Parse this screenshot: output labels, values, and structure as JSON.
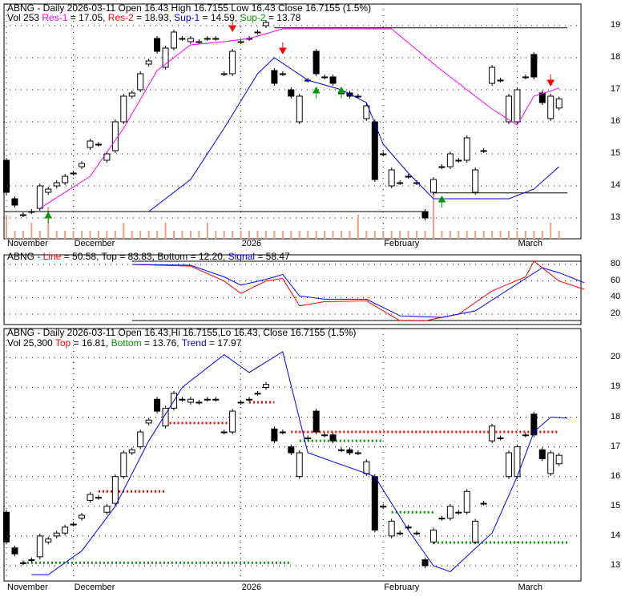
{
  "header1": {
    "line1": "ABNG - Daily 2026-03-11 Open 16.43  High 16.7155  Low 16.43  Close 16.7155 (1.5%)",
    "vol": "Vol 253",
    "res1_label": "Res-1",
    "res1": " = 17.05, ",
    "res2_label": "Res-2",
    "res2": " = 18.93, ",
    "sup1_label": "Sup-1",
    "sup1": " = 14.59, ",
    "sup2_label": "Sup-2",
    "sup2": " = 13.78"
  },
  "header2": {
    "prefix": "ABNG - ",
    "line_label": "Line",
    "line": " = 50.58, Top = 83.83, Bottom = 12.20, ",
    "signal_label": "Signal",
    "signal": " = 58.47"
  },
  "header3": {
    "line1": "ABNG - Daily 2026-03-11 Open 16.43,Hi 16.7155,Lo 16.43, Close 16.7155 (1.5%)",
    "vol": "Vol 25,300 ",
    "top_label": "Top",
    "top": " = 16.81, ",
    "bottom_label": "Bottom",
    "bottom": " = 13.76, ",
    "trend_label": "Trend",
    "trend": " = 17.97"
  },
  "colors": {
    "res1": "#ff00ff",
    "res2": "#ff0000",
    "sup1": "#0000ff",
    "sup2": "#009900",
    "volume": "#f4a080"
  },
  "chart_data": {
    "type": "candlestick",
    "title": "ABNG - Daily",
    "x_labels": [
      {
        "label": "November",
        "index": 0
      },
      {
        "label": "December",
        "index": 8
      },
      {
        "label": "2026",
        "index": 28
      },
      {
        "label": "February",
        "index": 45
      },
      {
        "label": "March",
        "index": 61
      }
    ],
    "price_ticks": [
      "13",
      "14",
      "15",
      "16",
      "17",
      "18",
      "19"
    ],
    "osc_ticks": [
      "20",
      "40",
      "60",
      "80"
    ],
    "trend_ticks": [
      "13",
      "14",
      "15",
      "16",
      "17",
      "18",
      "19",
      "20"
    ],
    "candles": [
      [
        14.8,
        13.8
      ],
      [
        13.6,
        13.4
      ],
      [
        13.1,
        13.1
      ],
      [
        13.2,
        13.2
      ],
      [
        13.3,
        14.0
      ],
      [
        13.8,
        13.9
      ],
      [
        14.0,
        14.1
      ],
      [
        14.1,
        14.3
      ],
      [
        14.4,
        14.4
      ],
      [
        14.6,
        14.7
      ],
      [
        15.2,
        15.4
      ],
      [
        15.3,
        15.3
      ],
      [
        14.8,
        15.0
      ],
      [
        15.1,
        16.0
      ],
      [
        16.0,
        16.8
      ],
      [
        16.8,
        16.9
      ],
      [
        17.0,
        17.5
      ],
      [
        17.8,
        17.9
      ],
      [
        18.6,
        18.2
      ],
      [
        17.7,
        18.3
      ],
      [
        18.3,
        18.8
      ],
      [
        18.6,
        18.6
      ],
      [
        18.5,
        18.6
      ],
      [
        18.5,
        18.5
      ],
      [
        18.6,
        18.6
      ],
      [
        18.6,
        18.6
      ],
      [
        17.5,
        17.5
      ],
      [
        17.5,
        18.2
      ],
      [
        18.5,
        18.5
      ],
      [
        18.6,
        18.6
      ],
      [
        18.8,
        18.8
      ],
      [
        19.0,
        19.1
      ],
      [
        17.6,
        17.2
      ],
      [
        17.5,
        17.5
      ],
      [
        17.0,
        16.8
      ],
      [
        16.0,
        16.8
      ],
      [
        17.3,
        17.3
      ],
      [
        18.2,
        17.5
      ],
      [
        17.4,
        17.4
      ],
      [
        17.4,
        17.2
      ],
      [
        16.9,
        16.9
      ],
      [
        16.9,
        16.8
      ],
      [
        16.8,
        16.8
      ],
      [
        16.1,
        16.5
      ],
      [
        16.0,
        14.2
      ],
      [
        15.0,
        15.0
      ],
      [
        14.0,
        14.5
      ],
      [
        14.1,
        14.1
      ],
      [
        14.3,
        14.3
      ],
      [
        14.1,
        14.1
      ],
      [
        13.2,
        13.0
      ],
      [
        13.8,
        14.2
      ],
      [
        14.6,
        14.6
      ],
      [
        14.6,
        15.0
      ],
      [
        14.8,
        14.8
      ],
      [
        14.8,
        15.5
      ],
      [
        13.8,
        14.5
      ],
      [
        15.1,
        15.1
      ],
      [
        17.2,
        17.7
      ],
      [
        17.3,
        17.3
      ],
      [
        16.0,
        16.8
      ],
      [
        16.0,
        17.0
      ],
      [
        17.4,
        17.4
      ],
      [
        18.1,
        17.4
      ],
      [
        16.9,
        16.6
      ],
      [
        16.1,
        16.8
      ],
      [
        16.43,
        16.7155
      ]
    ],
    "volume": [
      3,
      1,
      1,
      2,
      1,
      4,
      1,
      1,
      1,
      1,
      1,
      1,
      1,
      1,
      2,
      1,
      1,
      1,
      1,
      2,
      1,
      1,
      1,
      1,
      2,
      1,
      1,
      1,
      1,
      1,
      1,
      1,
      1,
      1,
      1,
      1,
      1,
      1,
      1,
      1,
      1,
      1,
      3,
      1,
      1,
      1,
      1,
      1,
      1,
      1,
      1,
      6,
      1,
      1,
      1,
      1,
      1,
      1,
      1,
      1,
      1,
      1,
      1,
      1,
      1,
      2,
      1
    ],
    "ma_blue": [
      [
        17,
        13.2
      ],
      [
        22,
        14.2
      ],
      [
        26,
        15.8
      ],
      [
        30,
        17.5
      ],
      [
        32,
        18.0
      ],
      [
        36,
        17.3
      ],
      [
        40,
        17.0
      ],
      [
        43,
        16.6
      ],
      [
        45,
        15.3
      ],
      [
        48,
        14.4
      ],
      [
        51,
        13.6
      ],
      [
        60,
        13.6
      ],
      [
        63,
        13.9
      ],
      [
        66,
        14.6
      ]
    ],
    "ma_magenta": [
      [
        4,
        13.3
      ],
      [
        10,
        14.3
      ],
      [
        14,
        15.8
      ],
      [
        18,
        17.6
      ],
      [
        22,
        18.4
      ],
      [
        26,
        18.5
      ],
      [
        29,
        18.6
      ],
      [
        33,
        18.9
      ],
      [
        46,
        18.9
      ],
      [
        52,
        17.6
      ],
      [
        58,
        16.4
      ],
      [
        61,
        15.9
      ],
      [
        63,
        16.8
      ],
      [
        66,
        17.05
      ]
    ],
    "osc_line": [
      [
        15,
        80
      ],
      [
        22,
        78
      ],
      [
        26,
        60
      ],
      [
        28,
        45
      ],
      [
        31,
        60
      ],
      [
        33,
        63
      ],
      [
        35,
        30
      ],
      [
        38,
        35
      ],
      [
        43,
        36
      ],
      [
        47,
        12
      ],
      [
        50,
        12
      ],
      [
        54,
        20
      ],
      [
        58,
        48
      ],
      [
        62,
        65
      ],
      [
        63,
        84
      ],
      [
        66,
        60
      ],
      [
        69,
        50
      ]
    ],
    "osc_signal": [
      [
        15,
        80
      ],
      [
        22,
        79
      ],
      [
        26,
        65
      ],
      [
        28,
        55
      ],
      [
        31,
        62
      ],
      [
        33,
        68
      ],
      [
        35,
        42
      ],
      [
        38,
        38
      ],
      [
        43,
        38
      ],
      [
        47,
        18
      ],
      [
        52,
        16
      ],
      [
        56,
        24
      ],
      [
        60,
        50
      ],
      [
        64,
        76
      ],
      [
        66,
        70
      ],
      [
        69,
        58
      ]
    ],
    "trend": [
      [
        3,
        12.7
      ],
      [
        5,
        12.7
      ],
      [
        9,
        13.5
      ],
      [
        13,
        15.0
      ],
      [
        17,
        17.2
      ],
      [
        21,
        19.0
      ],
      [
        26,
        20.1
      ],
      [
        29,
        19.5
      ],
      [
        33,
        20.2
      ],
      [
        36,
        16.8
      ],
      [
        44,
        16.0
      ],
      [
        48,
        14.2
      ],
      [
        51,
        13.0
      ],
      [
        53,
        12.8
      ],
      [
        58,
        14.1
      ],
      [
        61,
        16.0
      ],
      [
        63,
        17.5
      ],
      [
        65,
        18.0
      ],
      [
        67,
        17.97
      ]
    ]
  }
}
